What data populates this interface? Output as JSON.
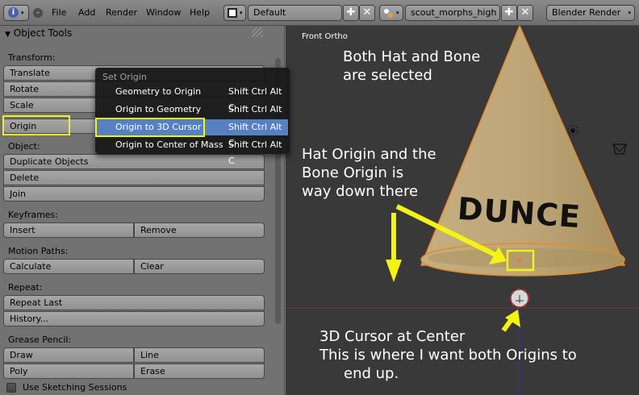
{
  "header": {
    "menu": [
      "File",
      "Add",
      "Render",
      "Window",
      "Help"
    ],
    "screen_layout": "Default",
    "scene": "scout_morphs_high",
    "render_engine": "Blender Render"
  },
  "panel": {
    "title": "Object Tools",
    "transform_label": "Transform:",
    "translate": "Translate",
    "rotate": "Rotate",
    "scale": "Scale",
    "origin": "Origin",
    "object_label": "Object:",
    "duplicate": "Duplicate Objects",
    "delete": "Delete",
    "join": "Join",
    "keyframes_label": "Keyframes:",
    "insert": "Insert",
    "remove": "Remove",
    "motion_label": "Motion Paths:",
    "calculate": "Calculate",
    "clear": "Clear",
    "repeat_label": "Repeat:",
    "repeat_last": "Repeat Last",
    "history": "History...",
    "grease_label": "Grease Pencil:",
    "draw": "Draw",
    "line": "Line",
    "poly": "Poly",
    "erase": "Erase",
    "sketching": "Use Sketching Sessions"
  },
  "menu": {
    "title": "Set Origin",
    "items": [
      {
        "label": "Geometry to Origin",
        "shortcut": "Shift Ctrl Alt C"
      },
      {
        "label": "Origin to Geometry",
        "shortcut": "Shift Ctrl Alt C"
      },
      {
        "label": "Origin to 3D Cursor",
        "shortcut": "Shift Ctrl Alt C"
      },
      {
        "label": "Origin to Center of Mass",
        "shortcut": "Shift Ctrl Alt C"
      }
    ]
  },
  "viewport": {
    "view_name": "Front Ortho",
    "hat_text": "DUNCE",
    "ann1_line1": "Both Hat and Bone",
    "ann1_line2": "are selected",
    "ann2_line1": "Hat Origin and the",
    "ann2_line2": "Bone Origin is",
    "ann2_line3": "way down there",
    "ann3_line1": "3D Cursor at Center",
    "ann3_line2": "This is where I want both Origins to",
    "ann3_line3": "end up."
  },
  "colors": {
    "highlight": "#f5f214",
    "menu_selected": "#5680c2",
    "viewport_bg": "#393939",
    "hat": "#bda77a"
  },
  "icons": [
    "info-icon",
    "collapse-icon",
    "layout-icon",
    "plus-icon",
    "close-icon",
    "scene-icon",
    "triangle-down-icon",
    "checkbox-icon",
    "camera-icon",
    "lamp-icon",
    "arrow-icon"
  ]
}
